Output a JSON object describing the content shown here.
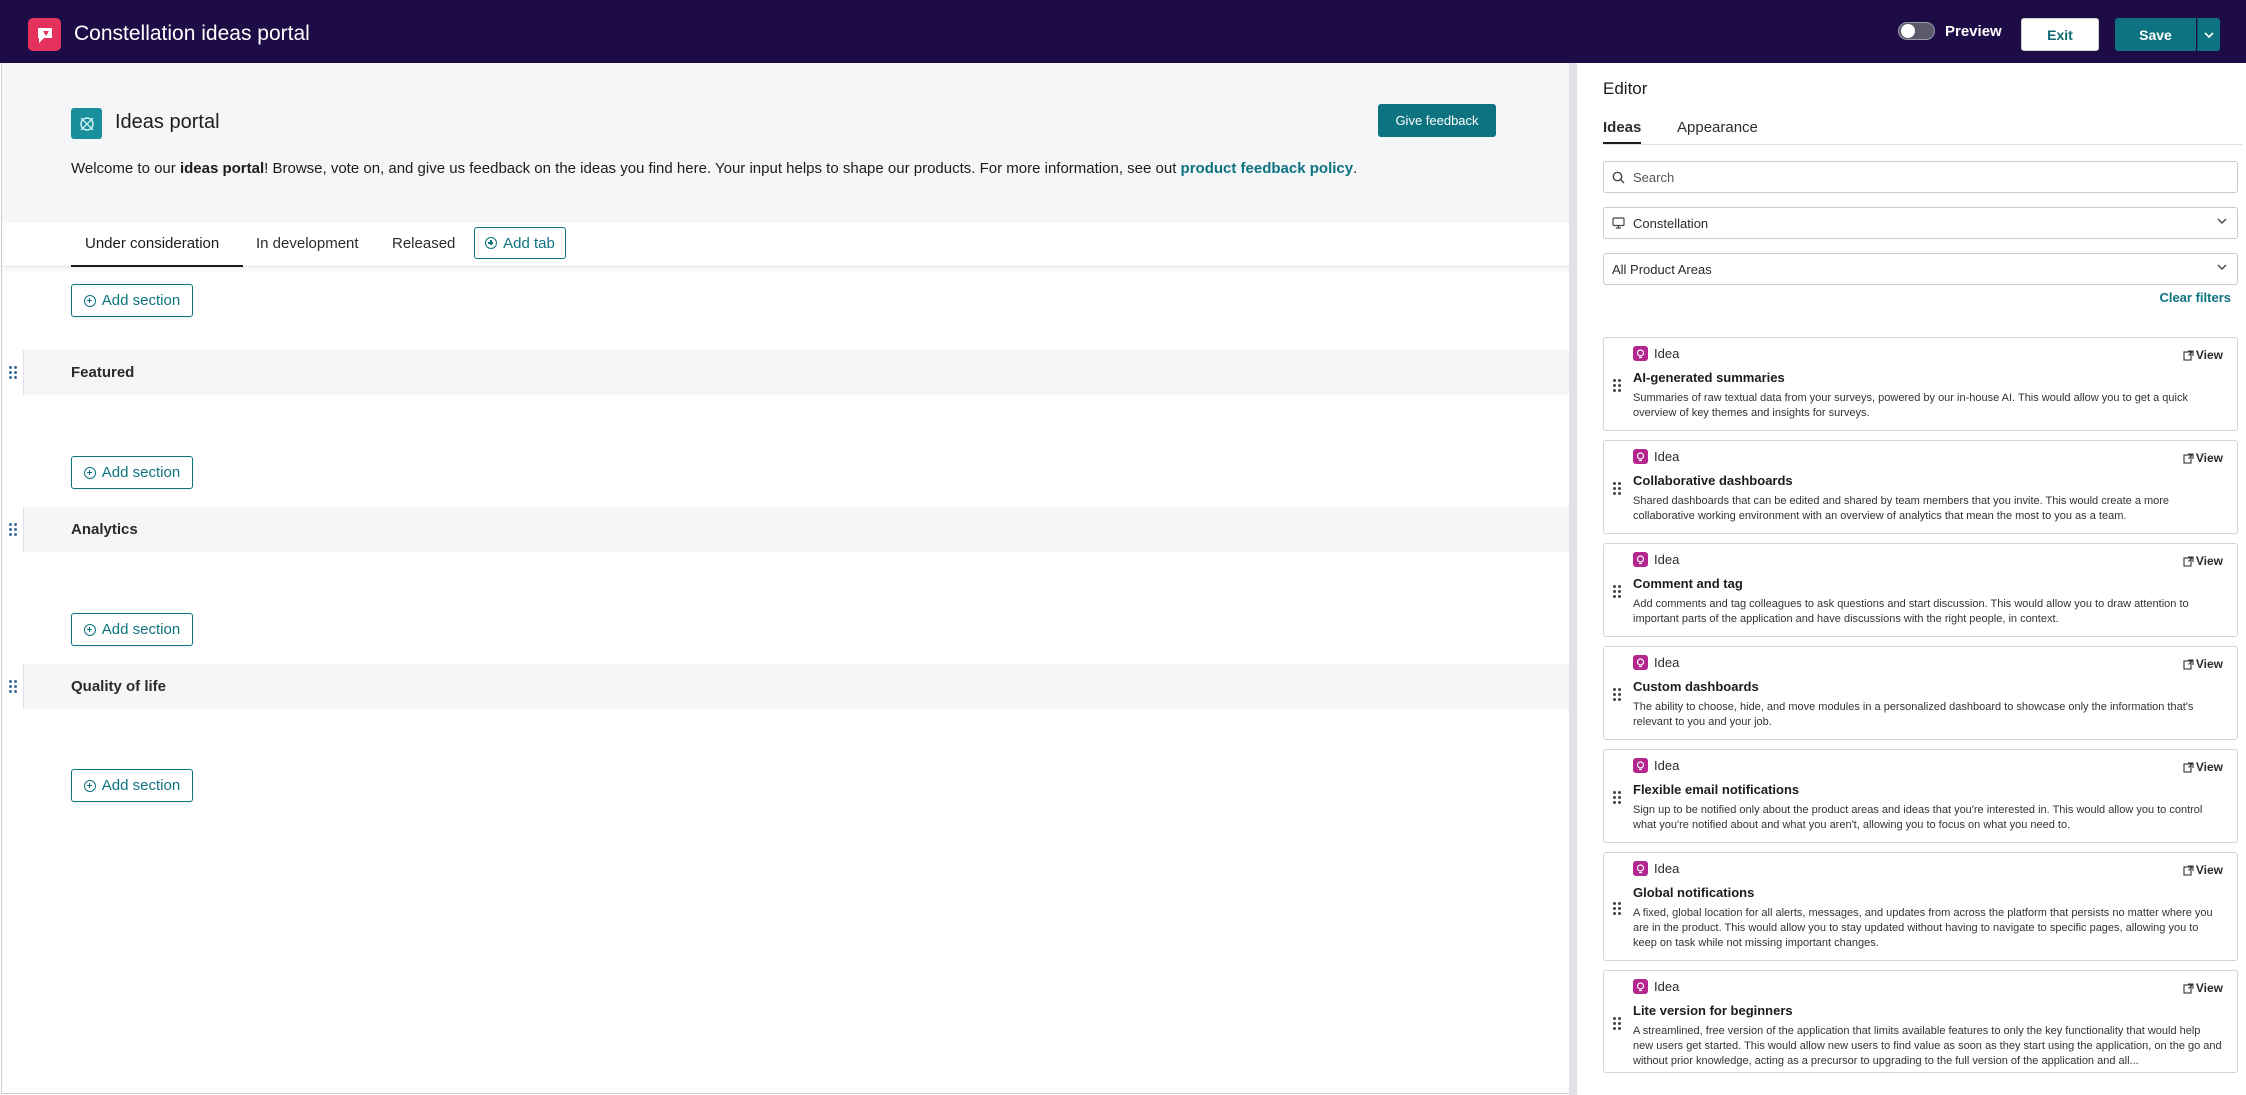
{
  "app": {
    "title": "Constellation ideas portal"
  },
  "topbar": {
    "preview_label": "Preview",
    "exit_label": "Exit",
    "save_label": "Save"
  },
  "portal": {
    "title": "Ideas portal",
    "feedback_label": "Give feedback",
    "welcome_pre": "Welcome to our ",
    "welcome_bold": "ideas portal",
    "welcome_mid": "! Browse, vote on, and give us feedback on the ideas you find here. Your input helps to shape our products. For more information, see out ",
    "welcome_link": "product feedback policy",
    "welcome_end": "."
  },
  "tabs": {
    "items": [
      "Under consideration",
      "In development",
      "Released"
    ],
    "active": "Under consideration",
    "add_label": "Add tab"
  },
  "sections": {
    "add_label": "Add section",
    "items": [
      "Featured",
      "Analytics",
      "Quality of life"
    ]
  },
  "editor": {
    "title": "Editor",
    "tabs": [
      "Ideas",
      "Appearance"
    ],
    "active_tab": "Ideas",
    "search_placeholder": "Search",
    "product_select": "Constellation",
    "area_select": "All Product Areas",
    "clear_filters": "Clear filters",
    "idea_type_label": "Idea",
    "view_label": "View",
    "ideas": [
      {
        "title": "AI-generated summaries",
        "description": "Summaries of raw textual data from your surveys, powered by our in-house AI. This would allow you to get a quick overview of key themes and insights for surveys."
      },
      {
        "title": "Collaborative dashboards",
        "description": "Shared dashboards that can be edited and shared by team members that you invite. This would create a more collaborative working environment with an overview of analytics that mean the most to you as a team."
      },
      {
        "title": "Comment and tag",
        "description": "Add comments and tag colleagues to ask questions and start discussion. This would allow you to draw attention to important parts of the application and have discussions with the right people, in context."
      },
      {
        "title": "Custom dashboards",
        "description": "The ability to choose, hide, and move modules in a personalized dashboard to showcase only the information that's relevant to you and your job."
      },
      {
        "title": "Flexible email notifications",
        "description": "Sign up to be notified only about the product areas and ideas that you're interested in. This would allow you to control what you're notified about and what you aren't, allowing you to focus on what you need to."
      },
      {
        "title": "Global notifications",
        "description": "A fixed, global location for all alerts, messages, and updates from across the platform that persists no matter where you are in the product. This would allow you to stay updated without having to navigate to specific pages, allowing you to keep on task while not missing important changes."
      },
      {
        "title": "Lite version for beginners",
        "description": "A streamlined, free version of the application that limits available features to only the key functionality that would help new users get started. This would allow new users to find value as soon as they start using the application, on the go and without prior knowledge, acting as a precursor to upgrading to the full version of the application and all..."
      }
    ]
  },
  "colors": {
    "topbar": "#1d0c45",
    "accent": "#0e7380",
    "logo": "#e5325d",
    "idea_icon": "#b3258f"
  }
}
